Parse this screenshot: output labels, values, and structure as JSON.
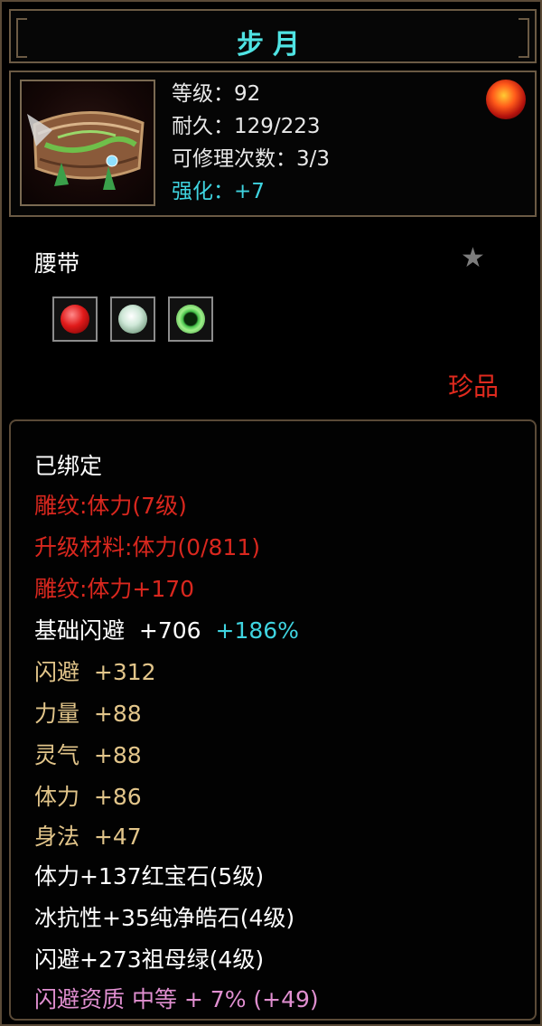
{
  "title": "步月",
  "header": {
    "level": "等级：92",
    "durability": "耐久：129/223",
    "repair_count": "可修理次数：3/3",
    "enhance": "强化：+7"
  },
  "item_type": "腰带",
  "rarity": "珍品",
  "bound_status": "已绑定",
  "engraving": {
    "engrave_title": "雕纹:体力(7级)",
    "upgrade_material": "升级材料:体力(0/811)",
    "engrave_bonus": "雕纹:体力+170"
  },
  "base_stat": {
    "label": "基础闪避",
    "value": "+706",
    "percent": "+186%"
  },
  "attributes": [
    {
      "name": "闪避",
      "value": "+312"
    },
    {
      "name": "力量",
      "value": "+88"
    },
    {
      "name": "灵气",
      "value": "+88"
    },
    {
      "name": "体力",
      "value": "+86"
    },
    {
      "name": "身法",
      "value": "+47"
    }
  ],
  "gem_bonuses": [
    "体力+137红宝石(5级)",
    "冰抗性+35纯净皓石(4级)",
    "闪避+273祖母绿(4级)"
  ],
  "aptitude": "闪避资质  中等 + 7% (+49)",
  "icons": {
    "portrait": "belt-icon",
    "orb": "fire-orb-icon",
    "star": "star-icon",
    "gems": [
      "ruby-gem-icon",
      "diamond-gem-icon",
      "emerald-gem-icon"
    ]
  },
  "colors": {
    "title": "#4fe3e3",
    "enhance": "#3fd4e0",
    "rarity": "#e02a1e",
    "engraving": "#d9271e",
    "attribute": "#e2c58a",
    "aptitude": "#e08fd0",
    "border": "#6b5a44"
  }
}
